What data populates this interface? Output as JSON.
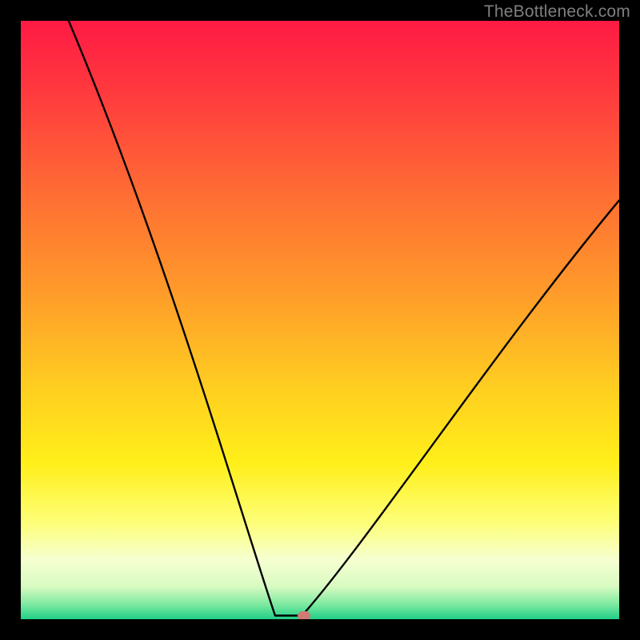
{
  "watermark": {
    "text": "TheBottleneck.com"
  },
  "colors": {
    "black": "#000000",
    "curve": "#000000",
    "marker": "#cf7a74",
    "watermark": "#7f7f7f",
    "gradient_stops": [
      {
        "offset": 0.0,
        "color": "#ff1a44"
      },
      {
        "offset": 0.12,
        "color": "#ff3a3e"
      },
      {
        "offset": 0.28,
        "color": "#ff6a34"
      },
      {
        "offset": 0.45,
        "color": "#ff9a2a"
      },
      {
        "offset": 0.62,
        "color": "#ffd020"
      },
      {
        "offset": 0.74,
        "color": "#ffef1a"
      },
      {
        "offset": 0.84,
        "color": "#fdff7a"
      },
      {
        "offset": 0.9,
        "color": "#f6ffd0"
      },
      {
        "offset": 0.945,
        "color": "#d9fbc2"
      },
      {
        "offset": 0.975,
        "color": "#7fe9a0"
      },
      {
        "offset": 1.0,
        "color": "#1fcf87"
      }
    ]
  },
  "chart_data": {
    "type": "line",
    "title": "",
    "xlabel": "",
    "ylabel": "",
    "xlim": [
      0,
      100
    ],
    "ylim": [
      0,
      100
    ],
    "grid": false,
    "legend": false,
    "series": [
      {
        "name": "bottleneck-curve",
        "x": [
          0,
          3,
          6,
          9,
          12,
          15,
          18,
          21,
          24,
          27,
          30,
          33,
          36,
          38,
          40,
          41.5,
          43,
          45,
          46,
          47,
          48.7,
          51,
          53,
          56,
          60,
          65,
          70,
          76,
          82,
          88,
          94,
          100
        ],
        "y": [
          100,
          92,
          84,
          77,
          70,
          63,
          56,
          49,
          43,
          37,
          31,
          25,
          19,
          14,
          10,
          6.5,
          4,
          2,
          1.2,
          0.8,
          0.6,
          1.5,
          3.5,
          8,
          14,
          22,
          31,
          40,
          49,
          57,
          64,
          70
        ]
      }
    ],
    "flat_bottom": {
      "x_start": 42.5,
      "x_end": 47.0,
      "y": 0.6
    },
    "marker": {
      "x": 47.3,
      "y": 0.6
    },
    "left_curve_start": {
      "x": 8.0,
      "y": 100
    }
  }
}
